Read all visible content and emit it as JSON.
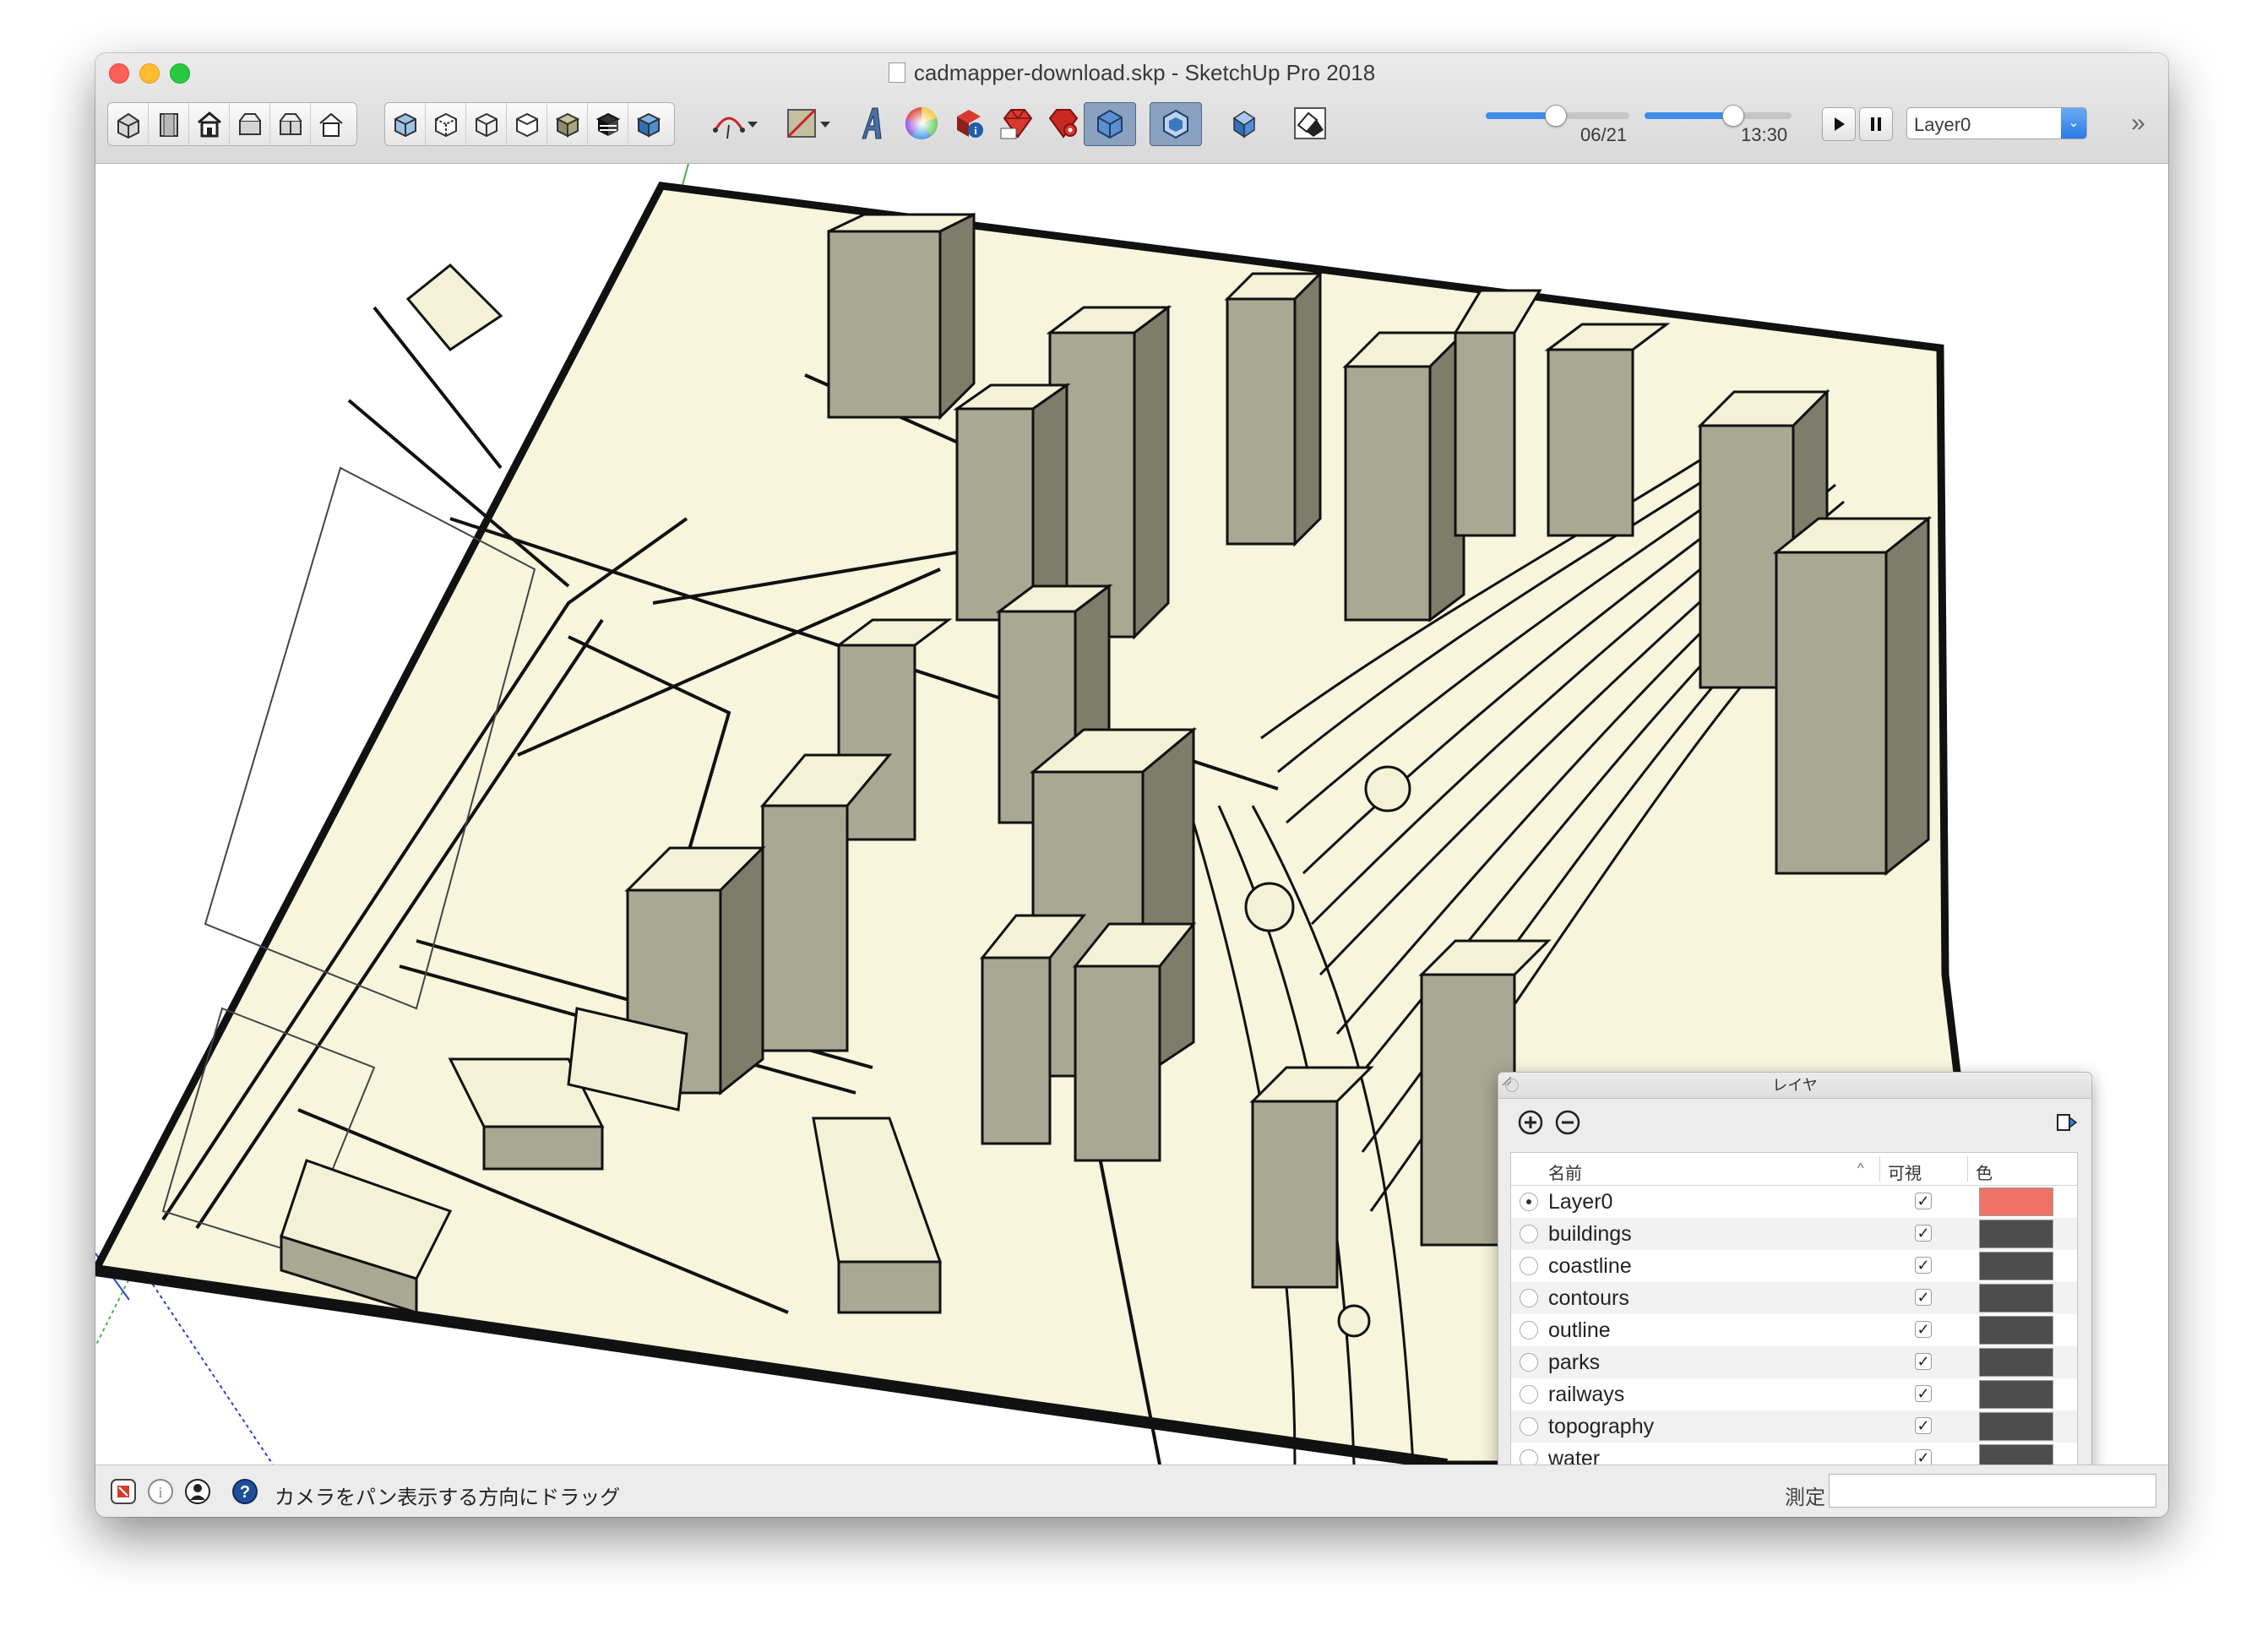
{
  "window": {
    "title": "cadmapper-download.skp - SketchUp Pro 2018"
  },
  "toolbar": {
    "views_icons": [
      "iso-view-icon",
      "top-view-icon",
      "front-view-icon",
      "right-view-icon",
      "back-view-icon",
      "left-view-icon"
    ],
    "styles_icons": [
      "xray-style-icon",
      "back-edges-style-icon",
      "wireframe-style-icon",
      "hidden-line-style-icon",
      "shaded-style-icon",
      "shaded-textures-style-icon",
      "monochrome-style-icon"
    ],
    "shadow_date": "06/21",
    "shadow_date_fraction": 0.48,
    "shadow_time": "13:30",
    "shadow_time_fraction": 0.6,
    "layer_current": "Layer0",
    "overflow_label": "»"
  },
  "status": {
    "hint": "カメラをパン表示する方向にドラッグ",
    "measure_label": "測定",
    "measure_value": ""
  },
  "layers_panel": {
    "title": "レイヤ",
    "col_name": "名前",
    "col_visible": "可視",
    "col_color": "色",
    "rows": [
      {
        "name": "Layer0",
        "active": true,
        "visible": true,
        "color": "#ee7266"
      },
      {
        "name": "buildings",
        "active": false,
        "visible": true,
        "color": "#4d4d4d"
      },
      {
        "name": "coastline",
        "active": false,
        "visible": true,
        "color": "#4d4d4d"
      },
      {
        "name": "contours",
        "active": false,
        "visible": true,
        "color": "#4d4d4d"
      },
      {
        "name": "outline",
        "active": false,
        "visible": true,
        "color": "#4d4d4d"
      },
      {
        "name": "parks",
        "active": false,
        "visible": true,
        "color": "#4d4d4d"
      },
      {
        "name": "railways",
        "active": false,
        "visible": true,
        "color": "#4d4d4d"
      },
      {
        "name": "topography",
        "active": false,
        "visible": true,
        "color": "#4d4d4d"
      },
      {
        "name": "water",
        "active": false,
        "visible": true,
        "color": "#4d4d4d"
      }
    ]
  },
  "colors": {
    "ground": "#f7f5dc",
    "building_top": "#f3f1d6",
    "building_side": "#a9a893",
    "building_dark": "#7e7d6a",
    "accent_blue": "#2a7ce6"
  }
}
